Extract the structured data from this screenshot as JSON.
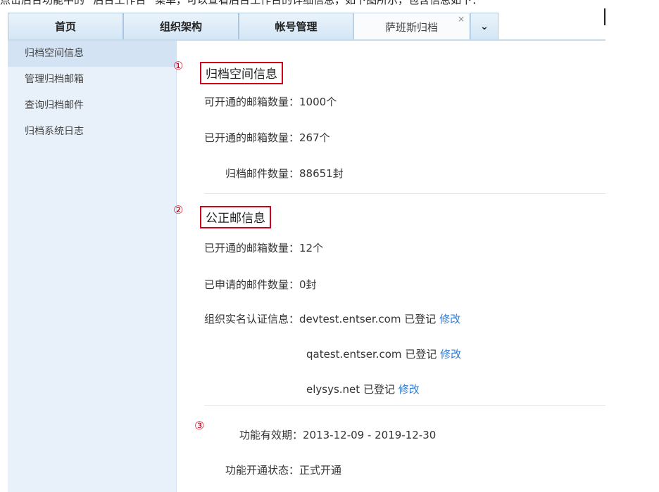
{
  "top_text": "点击后台功能中的 “后台工作台” 菜单，可以查看后台工作台的详细信息，如下图所示，包含信息如下：",
  "tabs": [
    {
      "label": "首页"
    },
    {
      "label": "组织架构"
    },
    {
      "label": "帐号管理"
    },
    {
      "label": "萨班斯归档",
      "active": true
    }
  ],
  "tab_close": "×",
  "tab_more": "⌄",
  "sidebar": {
    "items": [
      {
        "label": "归档空间信息",
        "active": true
      },
      {
        "label": "管理归档邮箱"
      },
      {
        "label": "查询归档邮件"
      },
      {
        "label": "归档系统日志"
      }
    ]
  },
  "marks": {
    "m1": "①",
    "m2": "②",
    "m3": "③"
  },
  "archive": {
    "title": "归档空间信息",
    "rows": [
      {
        "label": "可开通的邮箱数量：",
        "value": "1000个"
      },
      {
        "label": "已开通的邮箱数量：",
        "value": "267个"
      },
      {
        "label": "归档邮件数量：",
        "value": "88651封"
      }
    ]
  },
  "notary": {
    "title": "公正邮信息",
    "rows": [
      {
        "label": "已开通的邮箱数量：",
        "value": "12个"
      },
      {
        "label": "已申请的邮件数量：",
        "value": "0封"
      }
    ],
    "verify_label": "组织实名认证信息：",
    "domains": [
      {
        "domain": "devtest.entser.com",
        "status": "已登记",
        "action": "修改"
      },
      {
        "domain": "qatest.entser.com",
        "status": "已登记",
        "action": "修改"
      },
      {
        "domain": "elysys.net",
        "status": "已登记",
        "action": "修改"
      }
    ]
  },
  "function": {
    "validity_label": "功能有效期：",
    "validity_value": "2013-12-09 - 2019-12-30",
    "status_label": "功能开通状态：",
    "status_value": "正式开通"
  },
  "colors": {
    "accent_red": "#d0021b",
    "link_blue": "#2f7bd6",
    "sidebar_bg": "#e8f1fa",
    "tab_bg": "#d4e6f5"
  }
}
